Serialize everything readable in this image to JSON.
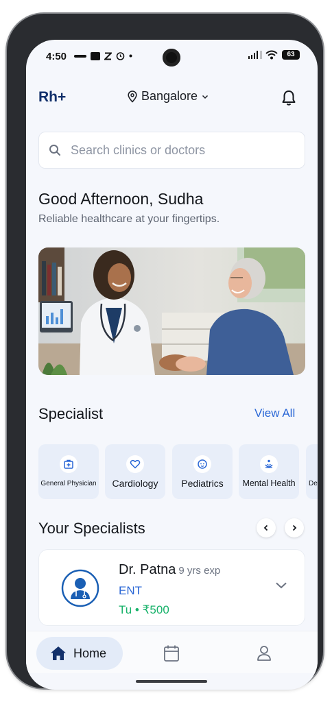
{
  "status_bar": {
    "time": "4:50",
    "battery": "63"
  },
  "header": {
    "logo": "Rh+",
    "location": "Bangalore"
  },
  "search": {
    "placeholder": "Search clinics or doctors"
  },
  "greeting": {
    "title": "Good Afternoon, Sudha",
    "subtitle": "Reliable healthcare at your fingertips."
  },
  "specialist_section": {
    "title": "Specialist",
    "view_all": "View All",
    "items": [
      {
        "label": "General Physician",
        "icon": "medical-kit-icon"
      },
      {
        "label": "Cardiology",
        "icon": "heart-icon"
      },
      {
        "label": "Pediatrics",
        "icon": "baby-face-icon"
      },
      {
        "label": "Mental Health",
        "icon": "lotus-icon"
      },
      {
        "label": "De",
        "icon": "tooth-icon"
      }
    ]
  },
  "your_specialists": {
    "title": "Your Specialists",
    "doctor": {
      "name": "Dr. Patna",
      "experience": "9 yrs exp",
      "specialty": "ENT",
      "fee": "Tu • ₹500"
    }
  },
  "bottom_nav": {
    "home_label": "Home"
  },
  "colors": {
    "brand": "#12306b",
    "accent_blue": "#2a67d6",
    "fee_green": "#17b26a",
    "background": "#f5f7fc",
    "chip_bg": "#e8eef9"
  }
}
